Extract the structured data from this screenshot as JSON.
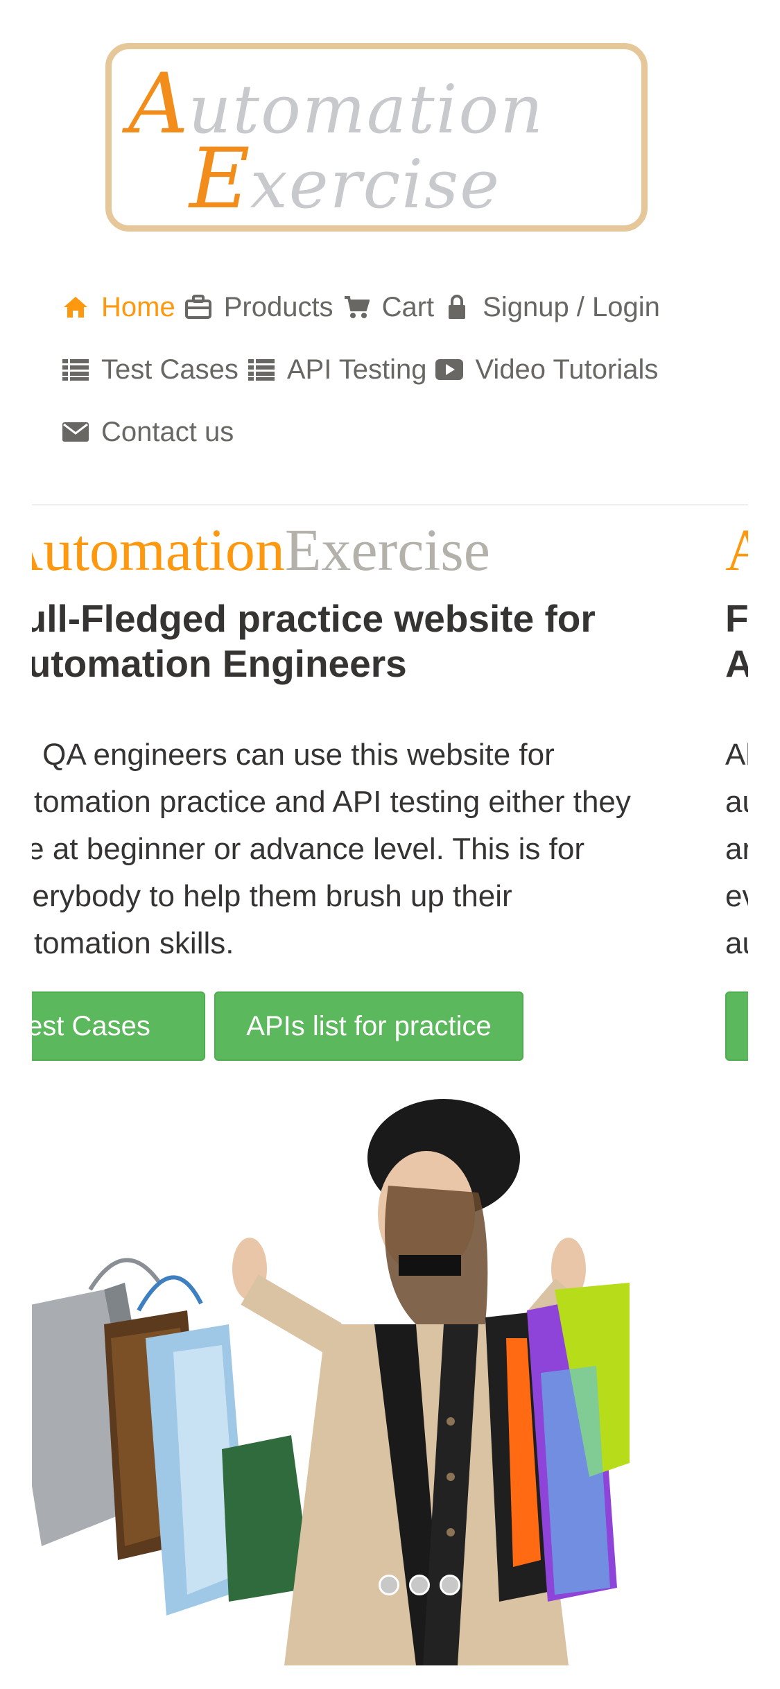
{
  "logo": {
    "line1_cap": "A",
    "line1_rest": "utomation",
    "line2_cap": "E",
    "line2_rest": "xercise"
  },
  "nav": {
    "items": [
      {
        "label": "Home",
        "icon": "home-icon",
        "active": true
      },
      {
        "label": "Products",
        "icon": "briefcase-icon"
      },
      {
        "label": "Cart",
        "icon": "cart-icon"
      },
      {
        "label": "Signup / Login",
        "icon": "lock-icon"
      },
      {
        "label": "Test Cases",
        "icon": "list-icon"
      },
      {
        "label": "API Testing",
        "icon": "list-icon"
      },
      {
        "label": "Video Tutorials",
        "icon": "youtube-play-icon"
      },
      {
        "label": "Contact us",
        "icon": "envelope-icon"
      }
    ]
  },
  "carousel": {
    "slide": {
      "brand_a": "Automation",
      "brand_b": "Exercise",
      "headline": "Full-Fledged practice website for Automation Engineers",
      "description": "All QA engineers can use this website for automation practice and API testing either they are at beginner or advance level. This is for everybody to help them brush up their automation skills.",
      "btn_test_cases": "Test Cases",
      "btn_apis": "APIs list for practice"
    },
    "indicator_count": 3
  },
  "colors": {
    "accent": "#fe980f",
    "button": "#5cb85c",
    "text": "#363432",
    "nav_text": "#696763"
  }
}
